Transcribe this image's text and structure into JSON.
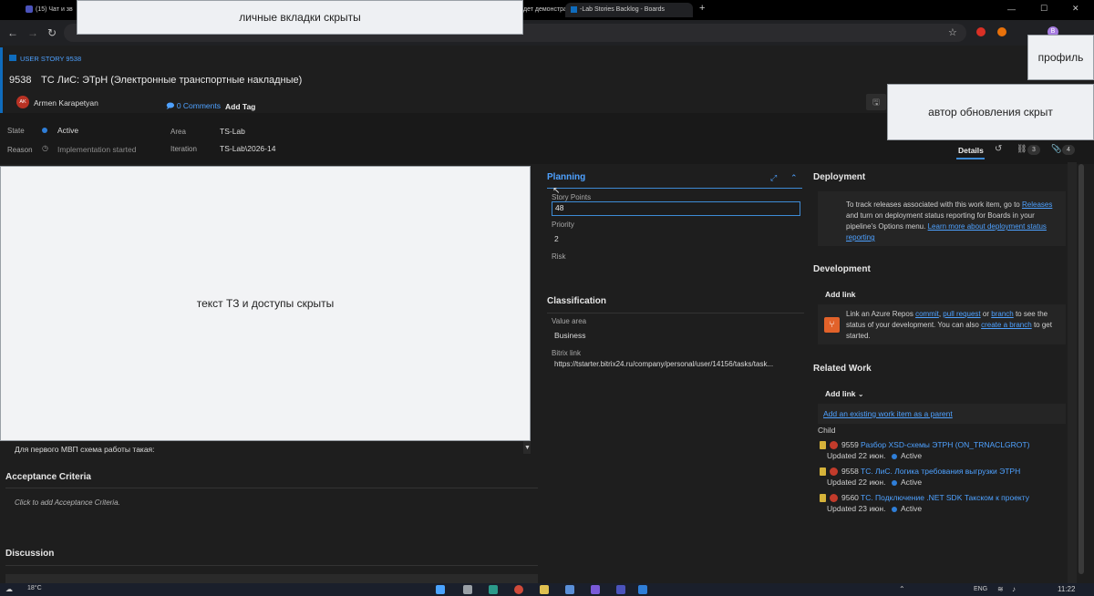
{
  "browser": {
    "tabs": [
      {
        "label": "(15) Чат и зв"
      },
      {
        "label": "дет демонстрация"
      },
      {
        "label": "-Lab Stories Backlog - Boards"
      }
    ],
    "new_tab_glyph": "+",
    "window_controls": {
      "min": "—",
      "max": "☐",
      "close": "✕"
    },
    "profile_letter": "B"
  },
  "overlays": {
    "tabs_hidden": "личные вкладки скрыты",
    "profile": "профиль",
    "author_hidden": "автор обновления скрыт",
    "spec_hidden": "текст ТЗ и доступы скрыты"
  },
  "work_item": {
    "type_label": "USER STORY 9538",
    "id": "9538",
    "title": "ТС ЛиС: ЭТрН (Электронные транспортные накладные)",
    "assignee_initials": "AK",
    "assignee": "Armen Karapetyan",
    "comments": "0 Comments",
    "add_tag": "Add Tag",
    "state_label": "State",
    "state_value": "Active",
    "reason_label": "Reason",
    "reason_value": "Implementation started",
    "area_label": "Area",
    "area_value": "TS-Lab",
    "iteration_label": "Iteration",
    "iteration_value": "TS-Lab\\2026-14",
    "details_tab": "Details",
    "links_count": "3",
    "attachments_count": "4"
  },
  "description": {
    "visible_line": "Для первого МВП схема работы такая:"
  },
  "acceptance": {
    "title": "Acceptance Criteria",
    "placeholder": "Click to add Acceptance Criteria."
  },
  "discussion": {
    "title": "Discussion"
  },
  "planning": {
    "title": "Planning",
    "story_points_label": "Story Points",
    "story_points_value": "48",
    "priority_label": "Priority",
    "priority_value": "2",
    "risk_label": "Risk"
  },
  "classification": {
    "title": "Classification",
    "value_area_label": "Value area",
    "value_area_value": "Business",
    "bitrix_label": "Bitrix link",
    "bitrix_value": "https://tstarter.bitrix24.ru/company/personal/user/14156/tasks/task..."
  },
  "deployment": {
    "title": "Deployment",
    "text_1": "To track releases associated with this work item, go to",
    "link_releases": "Releases",
    "text_2": "and turn on deployment status reporting for Boards in your pipeline's Options menu.",
    "link_learn": "Learn more about deployment status reporting"
  },
  "development": {
    "title": "Development",
    "add_link": "Add link",
    "text_1": "Link an Azure Repos",
    "link_commit": "commit",
    "link_pr": "pull request",
    "text_or": "or",
    "link_branch": "branch",
    "text_2": "to see the status of your development. You can also",
    "link_create_branch": "create a branch",
    "text_3": "to get started."
  },
  "related_work": {
    "title": "Related Work",
    "add_link": "Add link",
    "add_existing": "Add an existing work item as a parent",
    "child_label": "Child",
    "children": [
      {
        "id": "9559",
        "title": "Разбор XSD-схемы ЭТРН (ON_TRNACLGROT)",
        "updated": "Updated 22 июн.",
        "state": "Active"
      },
      {
        "id": "9558",
        "title": "ТС. ЛиС. Логика требования выгрузки ЭТРН",
        "updated": "Updated 22 июн.",
        "state": "Active"
      },
      {
        "id": "9560",
        "title": "ТС. Подключение .NET SDK Такском к проекту",
        "updated": "Updated 23 июн.",
        "state": "Active"
      }
    ]
  },
  "taskbar": {
    "weather": "18°C",
    "lang": "ENG",
    "time": "11:22"
  }
}
